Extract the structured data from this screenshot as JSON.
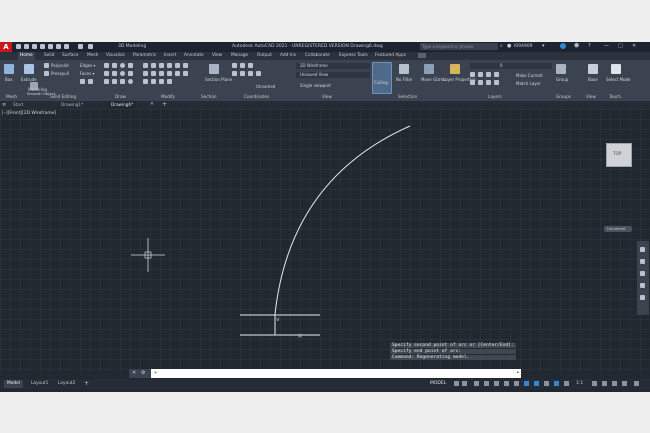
{
  "titlebar": {
    "workspace": "3D Modeling",
    "title": "Autodesk AutoCAD 2021 - UNREGISTERED VERSION   Drawing6.dwg",
    "search_placeholder": "Type a keyword or phrase",
    "user": "l094909"
  },
  "ribbon_tabs": [
    "Home",
    "Solid",
    "Surface",
    "Mesh",
    "Visualize",
    "Parametric",
    "Insert",
    "Annotate",
    "View",
    "Manage",
    "Output",
    "Add-ins",
    "Collaborate",
    "Express Tools",
    "Featured Apps"
  ],
  "ribbon": {
    "box": "Box",
    "extrude": "Extrude",
    "polysolid": "Polysolid",
    "presspull": "Presspull",
    "smooth_object": "Smooth Object",
    "modeling": "Modeling",
    "mesh": "Mesh",
    "solid_editing": "Solid Editing",
    "draw": "Draw",
    "modify": "Modify",
    "section_plane": "Section Plane",
    "section": "Section",
    "unnamed": "Unnamed",
    "coordinates": "Coordinates",
    "visual_style": "2D Wireframe",
    "view_name": "Unsaved View",
    "viewport": "Single viewport",
    "view": "View",
    "culling": "Culling",
    "no_filter": "No Filter",
    "move_gizmo": "Move Gizmo",
    "selection": "Selection",
    "layer_properties": "Layer Properties",
    "layer_value": "0",
    "make_current": "Make Current",
    "match_layer": "Match Layer",
    "layers": "Layers",
    "group": "Group",
    "groups": "Groups",
    "base": "Base",
    "view_panel": "View",
    "select_mode": "Select Mode",
    "touch": "Touch"
  },
  "doc_tabs": [
    "Start",
    "Drawing1*",
    "Drawing6*"
  ],
  "viewport": {
    "label": "[–][Front][2D Wireframe]",
    "viewcube_face": "TOP",
    "viewcube_wcs": "Unnamed"
  },
  "command": {
    "history": [
      "Specify second point of arc or [Center/End]:",
      "Specify end point of arc:",
      "Command:  Regenerating model."
    ],
    "input_value": "",
    "prompt_glyph": "»"
  },
  "status": {
    "layout_tabs": [
      "Model",
      "Layout1",
      "Layout2"
    ],
    "mode": "MODEL",
    "scale": "1:1"
  },
  "colors": {
    "canvas": "#212830",
    "ribbon": "#3b4350",
    "accent": "#2d8ad6",
    "brand": "#c8181f"
  }
}
